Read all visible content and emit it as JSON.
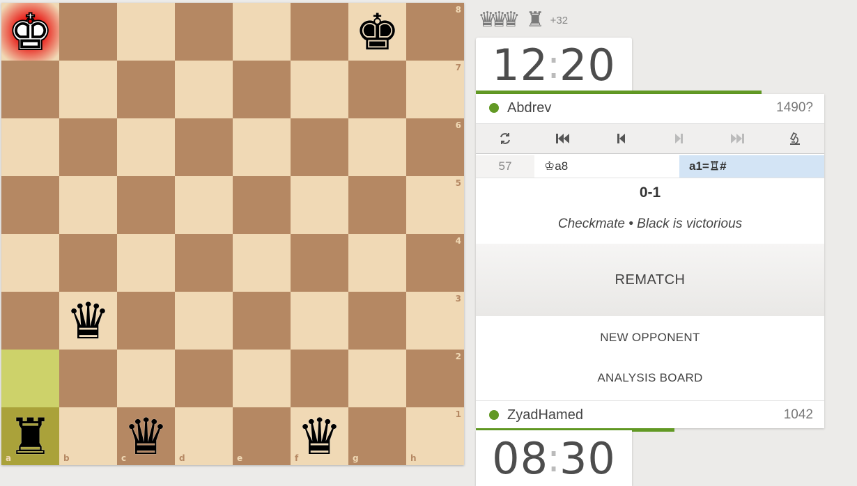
{
  "board": {
    "files": [
      "a",
      "b",
      "c",
      "d",
      "e",
      "f",
      "g",
      "h"
    ],
    "ranks": [
      "8",
      "7",
      "6",
      "5",
      "4",
      "3",
      "2",
      "1"
    ],
    "pieces": [
      {
        "square": "a8",
        "piece": "king",
        "color": "white",
        "glyph": "♚",
        "in_check": true
      },
      {
        "square": "g8",
        "piece": "king",
        "color": "black",
        "glyph": "♚"
      },
      {
        "square": "b3",
        "piece": "queen",
        "color": "black",
        "glyph": "♛"
      },
      {
        "square": "a1",
        "piece": "rook",
        "color": "black",
        "glyph": "♜"
      },
      {
        "square": "c1",
        "piece": "queen",
        "color": "black",
        "glyph": "♛"
      },
      {
        "square": "f1",
        "piece": "queen",
        "color": "black",
        "glyph": "♛"
      }
    ],
    "last_move": [
      "a2",
      "a1"
    ],
    "colors": {
      "light": "#f0d9b5",
      "dark": "#b58863",
      "highlight_light": "#cdd26a",
      "highlight_dark": "#aaa23a"
    }
  },
  "material": {
    "captured_glyphs": [
      "♛",
      "♛",
      "♛",
      "♜"
    ],
    "score": "+32"
  },
  "top_clock": {
    "minutes": "12",
    "seconds": "20",
    "separator": ":",
    "time_remaining_fraction": 0.82
  },
  "bottom_clock": {
    "minutes": "08",
    "seconds": "30",
    "separator": ":",
    "time_remaining_fraction": 0.57
  },
  "top_player": {
    "name": "Abdrev",
    "rating": "1490?",
    "online": true
  },
  "bottom_player": {
    "name": "ZyadHamed",
    "rating": "1042",
    "online": true
  },
  "controls": [
    {
      "name": "flip-board-icon",
      "glyph": "⟲",
      "enabled": true
    },
    {
      "name": "first-move-icon",
      "glyph": "⏮",
      "enabled": true
    },
    {
      "name": "previous-move-icon",
      "glyph": "⏴",
      "enabled": true
    },
    {
      "name": "next-move-icon",
      "glyph": "⏵",
      "enabled": false
    },
    {
      "name": "last-move-icon",
      "glyph": "⏭",
      "enabled": false
    },
    {
      "name": "analysis-microscope-icon",
      "glyph": "⚲",
      "enabled": true
    }
  ],
  "moves": {
    "number": "57",
    "white": "♔a8",
    "black": "a1=♖#"
  },
  "result": {
    "score": "0-1",
    "status": "Checkmate • Black is victorious"
  },
  "buttons": {
    "rematch": "REMATCH",
    "new_opponent": "NEW OPPONENT",
    "analysis_board": "ANALYSIS BOARD"
  },
  "accent_color": "#629924"
}
